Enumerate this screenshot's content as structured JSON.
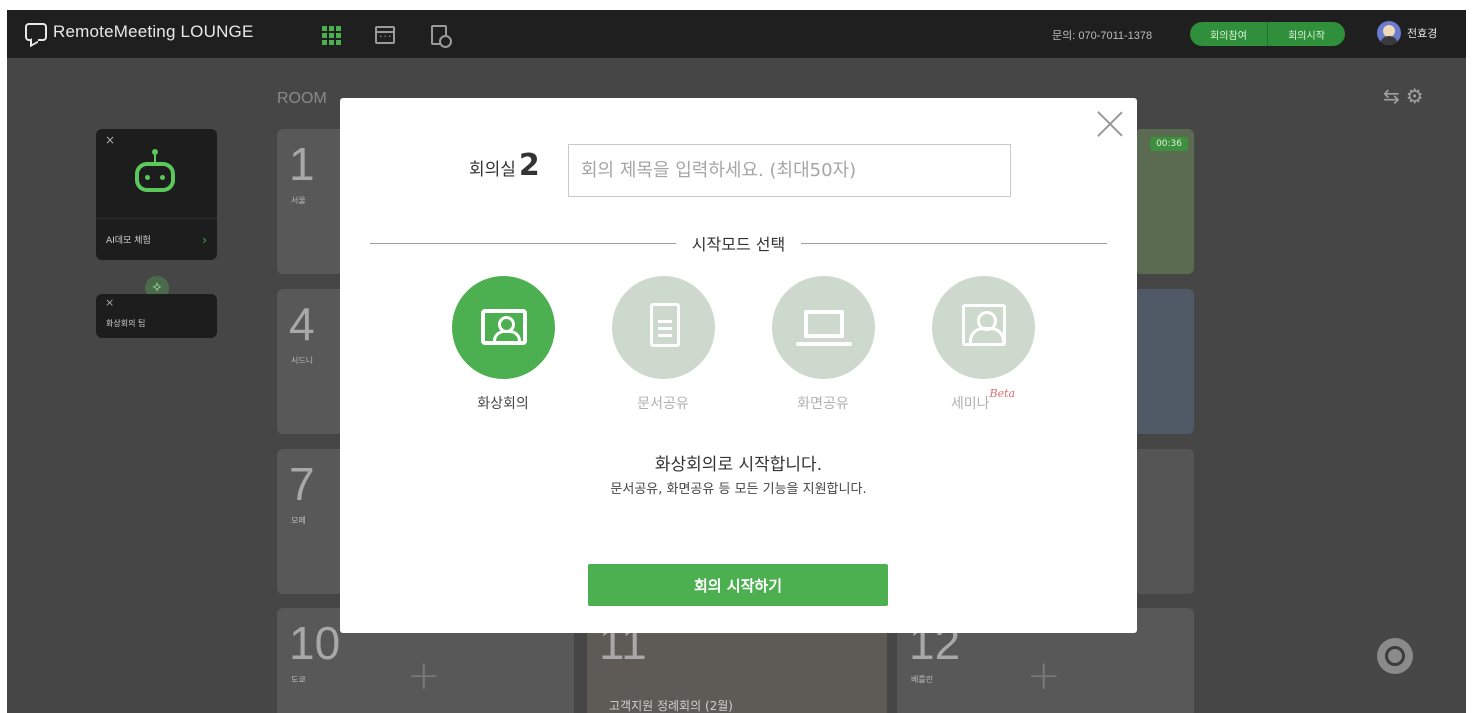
{
  "header": {
    "logo_text": "RemoteMeeting LOUNGE",
    "nav_icons": [
      "grid-icon",
      "calendar-icon",
      "document-icon"
    ],
    "contact": "문의: 070-7011-1378",
    "join_button": "회의참여",
    "start_button": "회의시작",
    "user_name": "전효경",
    "accent_color": "#4caf50"
  },
  "background": {
    "room_list_label": "ROOM",
    "ai_card_label": "AI데모 체험",
    "tip_card_label": "화상회의 팁",
    "tiles": [
      {
        "num": "1",
        "city": "서울"
      },
      {
        "num": "4",
        "city": "시드니"
      },
      {
        "num": "7",
        "city": "모페"
      },
      {
        "num": "10",
        "city": "도쿄"
      },
      {
        "num": "11",
        "city": "",
        "title": "고객지원 정례회의 (2월)"
      },
      {
        "num": "12",
        "city": "베를린"
      }
    ],
    "top_right_timer": "00:36"
  },
  "modal": {
    "room_label": "회의실",
    "room_number": "2",
    "title_placeholder": "회의 제목을 입력하세요. (최대50자)",
    "title_value": "",
    "mode_heading": "시작모드 선택",
    "modes": [
      {
        "label": "화상회의",
        "icon": "video-conference-icon",
        "selected": true
      },
      {
        "label": "문서공유",
        "icon": "document-share-icon",
        "selected": false
      },
      {
        "label": "화면공유",
        "icon": "screen-share-icon",
        "selected": false
      },
      {
        "label": "세미나",
        "icon": "seminar-icon",
        "selected": false,
        "badge": "Beta"
      }
    ],
    "description_main": "화상회의로 시작합니다.",
    "description_sub": "문서공유, 화면공유 등 모든 기능을 지원합니다.",
    "start_button": "회의 시작하기"
  }
}
